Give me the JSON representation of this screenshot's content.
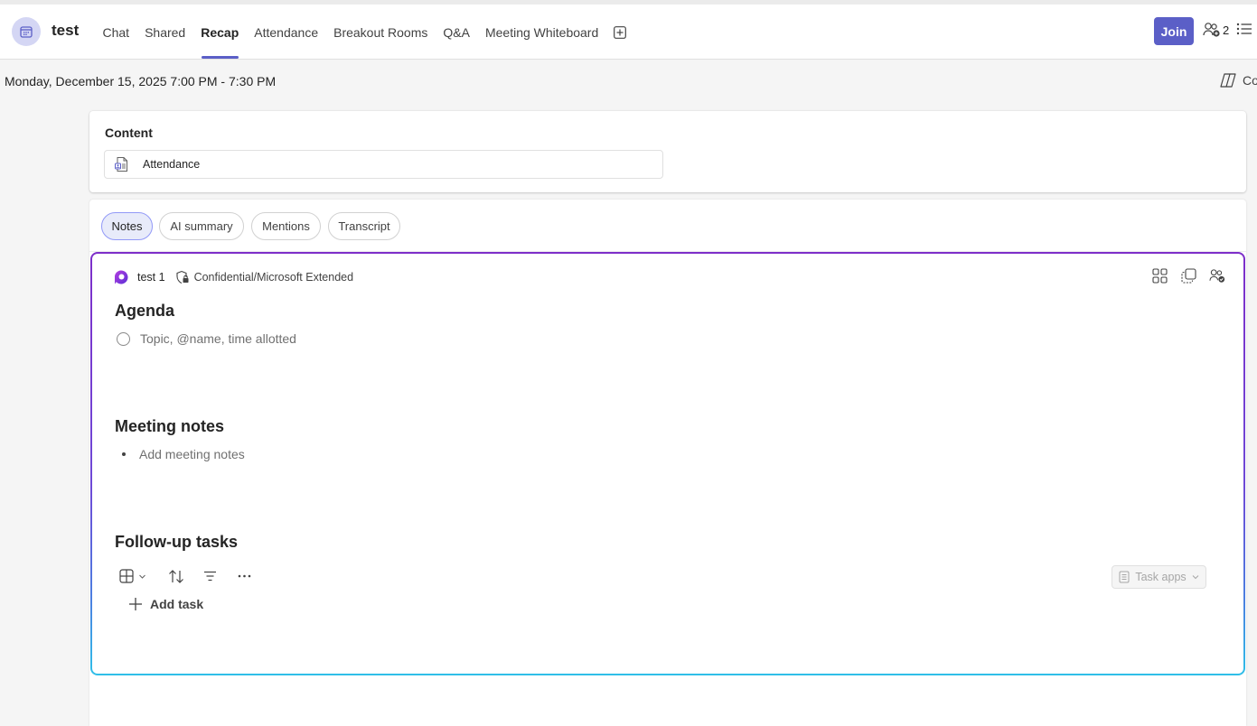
{
  "header": {
    "meeting_title": "test",
    "tabs": [
      {
        "label": "Chat",
        "active": false
      },
      {
        "label": "Shared",
        "active": false
      },
      {
        "label": "Recap",
        "active": true
      },
      {
        "label": "Attendance",
        "active": false
      },
      {
        "label": "Breakout Rooms",
        "active": false
      },
      {
        "label": "Q&A",
        "active": false
      },
      {
        "label": "Meeting Whiteboard",
        "active": false
      }
    ],
    "join_label": "Join",
    "participant_count": "2"
  },
  "recap": {
    "date_time": "Monday, December 15, 2025 7:00 PM - 7:30 PM",
    "copilot_label": "Co",
    "content": {
      "heading": "Content",
      "items": [
        {
          "name": "Attendance",
          "icon": "attendance-report-icon"
        }
      ]
    },
    "pills": [
      "Notes",
      "AI summary",
      "Mentions",
      "Transcript"
    ],
    "active_pill": "Notes"
  },
  "notes": {
    "loop_name": "test 1",
    "sensitivity_label": "Confidential/Microsoft Extended",
    "agenda": {
      "title": "Agenda",
      "placeholder": "Topic, @name, time allotted"
    },
    "meeting_notes": {
      "title": "Meeting notes",
      "placeholder": "Add meeting notes"
    },
    "followup": {
      "title": "Follow-up tasks",
      "task_apps_label": "Task apps",
      "add_task_label": "Add task"
    }
  },
  "colors": {
    "accent": "#5b5fc7",
    "active_pill_bg": "#e8ebfa",
    "loop_border_top": "#7d2ec9",
    "loop_border_bottom": "#2fbfe8"
  }
}
